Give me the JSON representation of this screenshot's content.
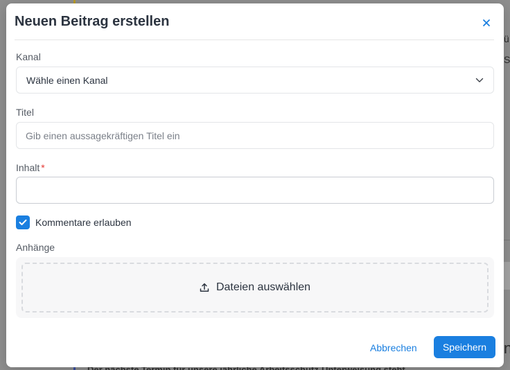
{
  "modal": {
    "title": "Neuen Beitrag erstellen"
  },
  "form": {
    "channel_label": "Kanal",
    "channel_value": "Wähle einen Kanal",
    "title_label": "Titel",
    "title_placeholder": "Gib einen aussagekräftigen Titel ein",
    "content_label": "Inhalt",
    "content_required_mark": "*",
    "allow_comments_label": "Kommentare erlauben",
    "allow_comments_checked": true,
    "attachments_label": "Anhänge",
    "choose_files_label": "Dateien auswählen"
  },
  "actions": {
    "cancel_label": "Abbrechen",
    "save_label": "Speichern"
  },
  "background": {
    "right_text_a": "ü",
    "right_text_b": "S",
    "right_text_c": "n",
    "bottom_text": "Der nächste Termin für unsere jährliche Arbeitsschutz-Unterweisung steht"
  },
  "colors": {
    "accent": "#1a7fe0",
    "required": "#e53935"
  }
}
